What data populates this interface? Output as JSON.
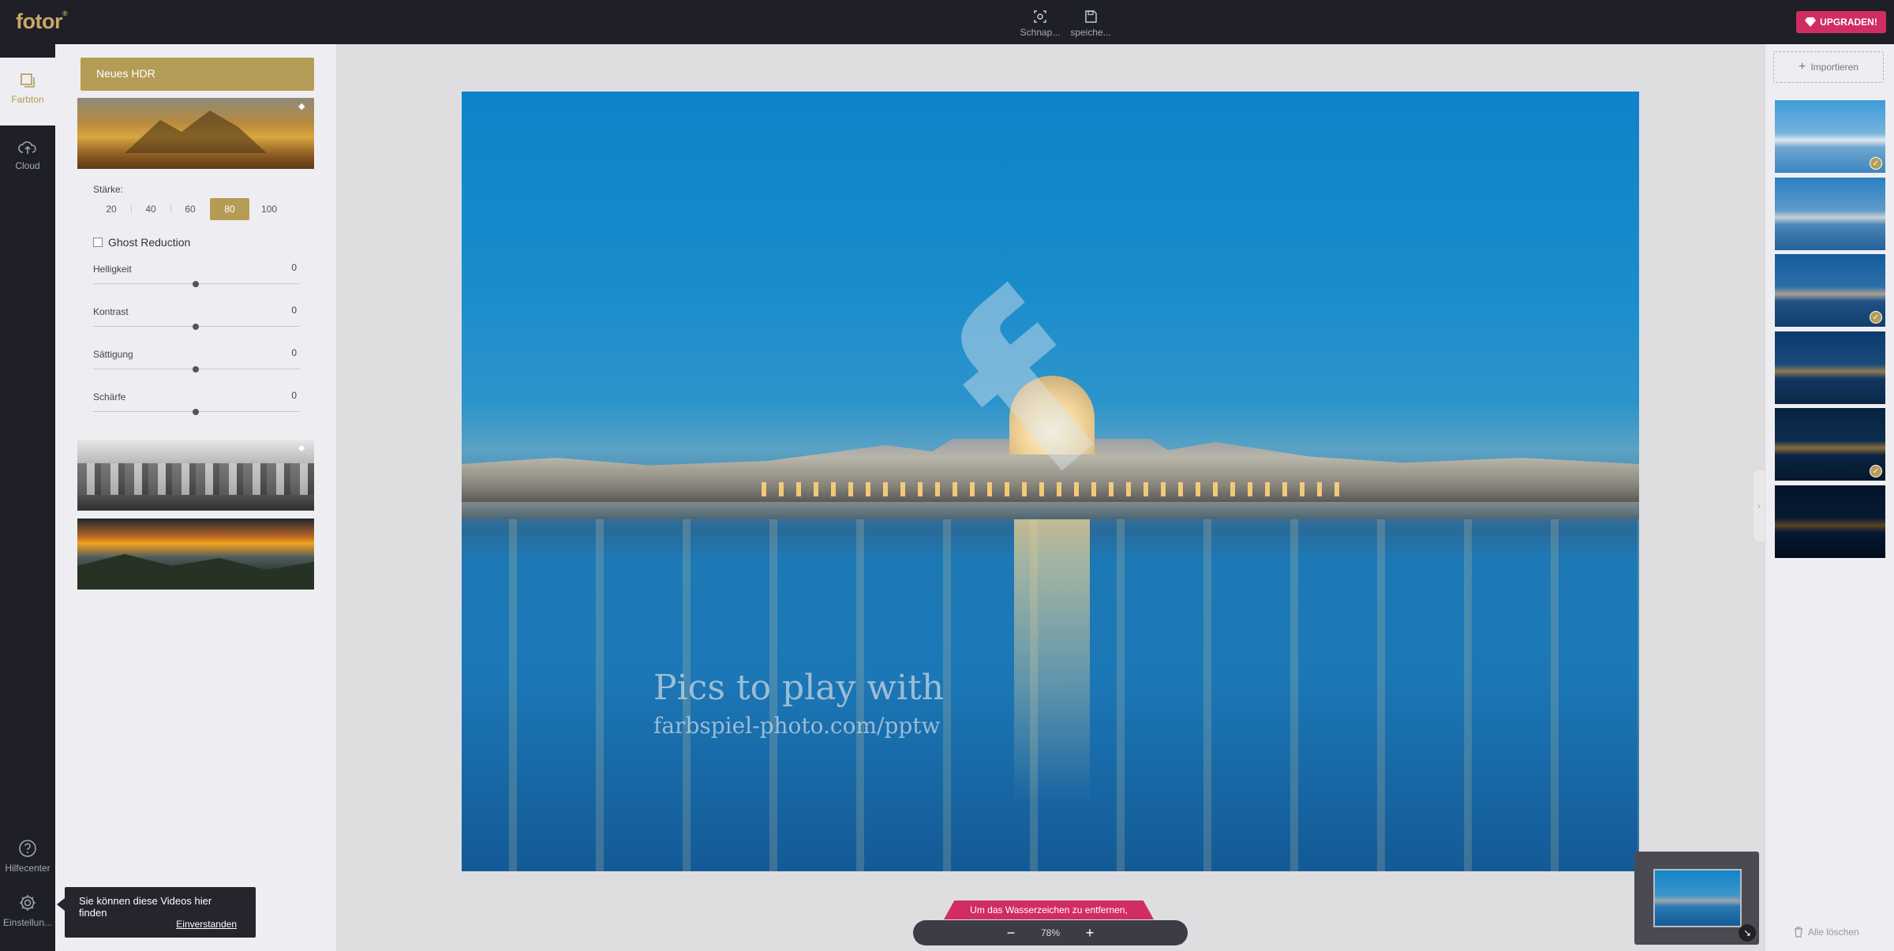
{
  "app": {
    "logo": "fotor"
  },
  "topbar": {
    "snapshot_label": "Schnap...",
    "save_label": "speiche...",
    "upgrade_label": "UPGRADEN!"
  },
  "leftnav": {
    "farbton_label": "Farbton",
    "cloud_label": "Cloud",
    "help_label": "Hilfecenter",
    "settings_label": "Einstellun..."
  },
  "panel": {
    "hdr_button": "Neues HDR",
    "strength_label": "Stärke:",
    "strength_options": [
      "20",
      "40",
      "60",
      "80",
      "100"
    ],
    "strength_selected": "80",
    "ghost_reduction_label": "Ghost Reduction",
    "ghost_reduction_checked": false,
    "sliders": [
      {
        "label": "Helligkeit",
        "value": "0"
      },
      {
        "label": "Kontrast",
        "value": "0"
      },
      {
        "label": "Sättigung",
        "value": "0"
      },
      {
        "label": "Schärfe",
        "value": "0"
      }
    ]
  },
  "canvas": {
    "watermark_line1": "Pics to play with",
    "watermark_line2": "farbspiel-photo.com/pptw",
    "watermark_notice": "Um das Wasserzeichen zu entfernen,",
    "zoom": "78%",
    "zoom_minus": "−",
    "zoom_plus": "+"
  },
  "rightpanel": {
    "import_label": "Importieren",
    "delete_all_label": "Alle löschen",
    "thumbnails": [
      {
        "checked": true
      },
      {
        "checked": false
      },
      {
        "checked": true
      },
      {
        "checked": false
      },
      {
        "checked": true
      },
      {
        "checked": false
      }
    ]
  },
  "tooltip": {
    "text": "Sie können diese Videos hier finden",
    "confirm": "Einverstanden"
  },
  "colors": {
    "accent_gold": "#b59c56",
    "upgrade_pink": "#d12d62",
    "dark_bg": "#1e1f27"
  }
}
